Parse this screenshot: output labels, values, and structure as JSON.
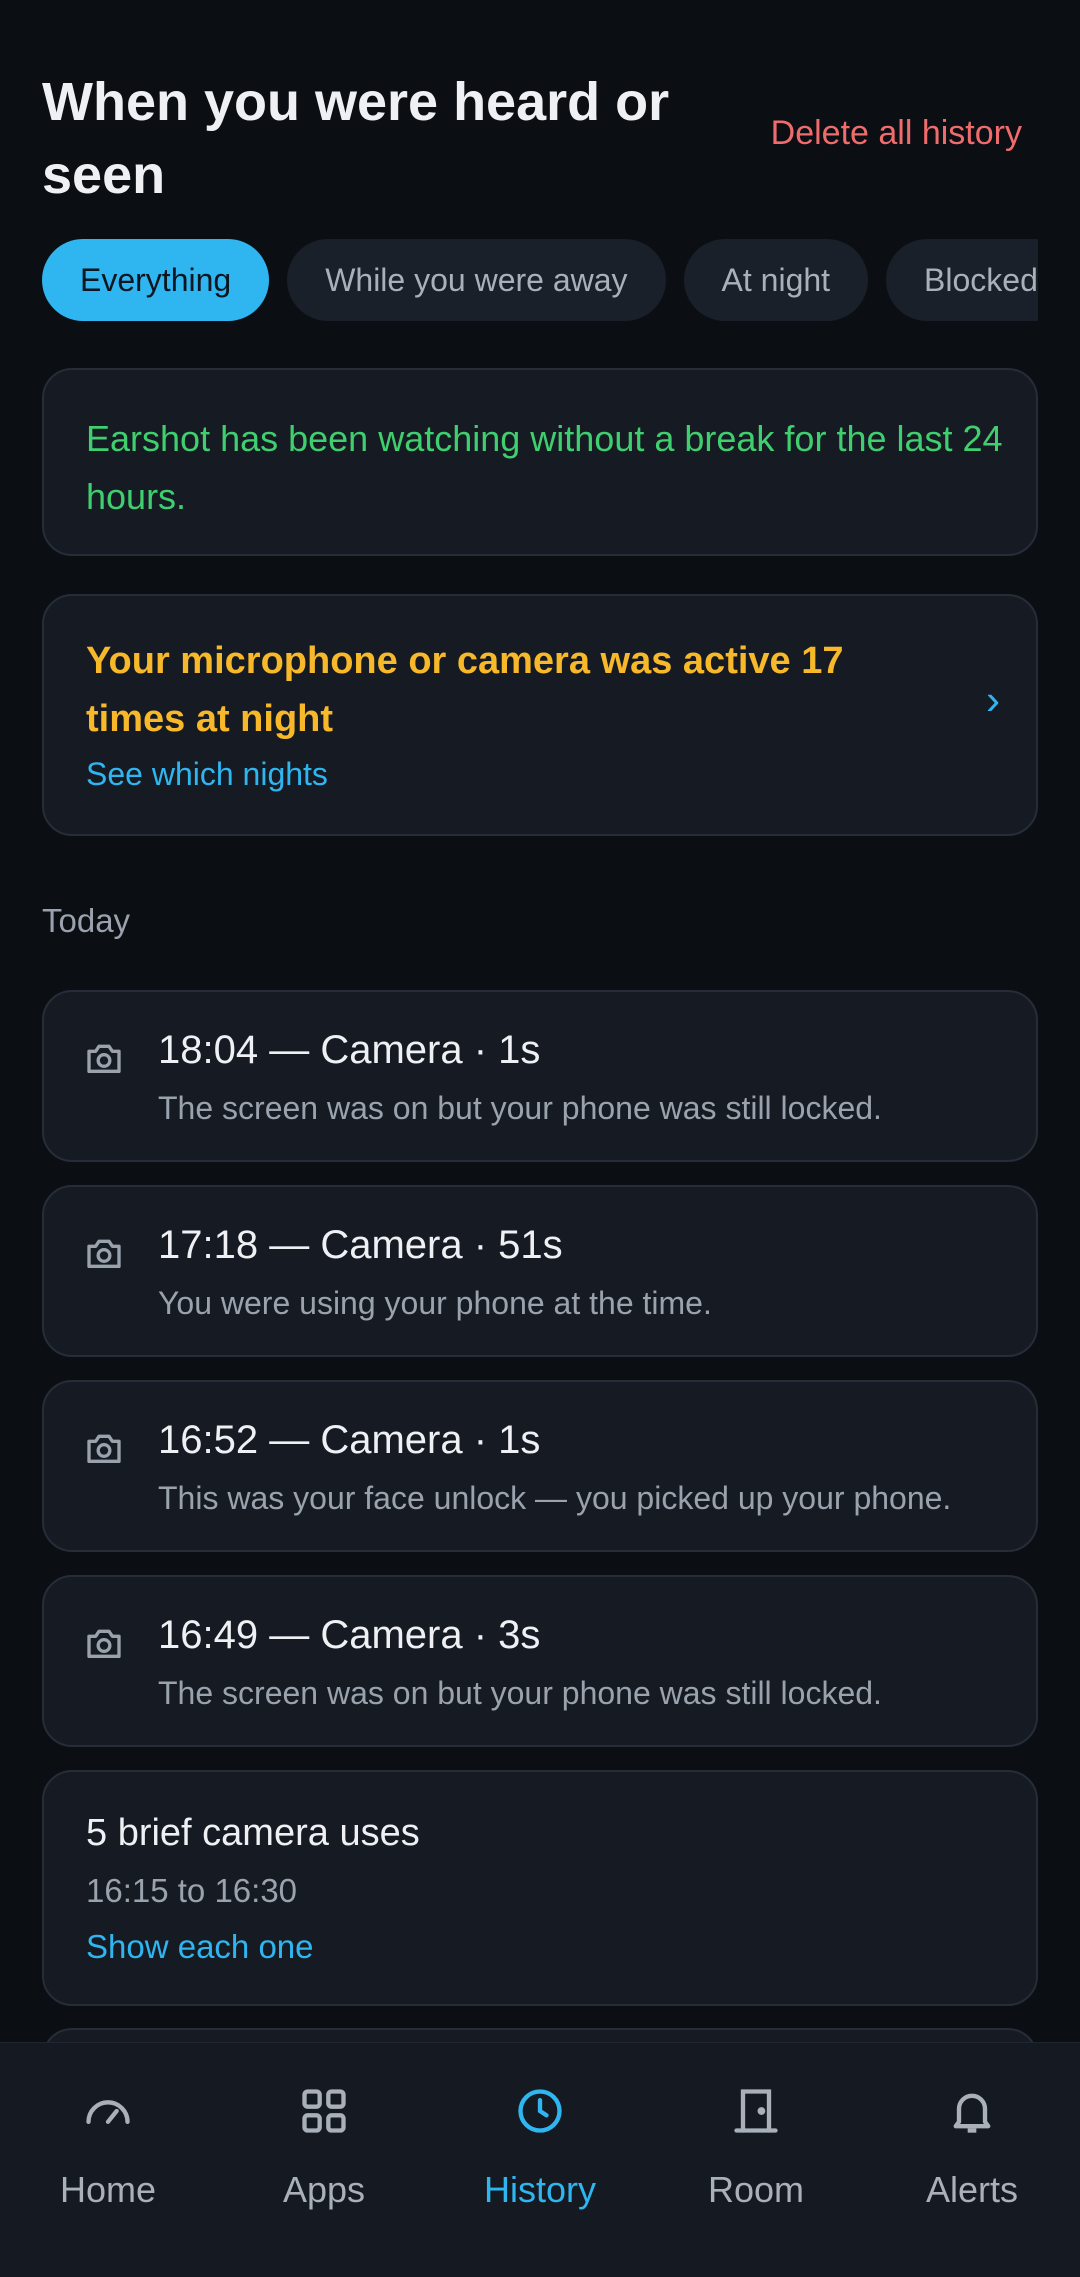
{
  "header": {
    "title": "When you were heard or seen",
    "delete_label": "Delete all history"
  },
  "filters": [
    {
      "label": "Everything",
      "active": true
    },
    {
      "label": "While you were away",
      "active": false
    },
    {
      "label": "At night",
      "active": false
    },
    {
      "label": "Blocked",
      "active": false
    }
  ],
  "watch_status": "Earshot has been watching without a break for the last 24 hours.",
  "night_alert": {
    "title": "Your microphone or camera was active 17 times at night",
    "link": "See which nights"
  },
  "section_label": "Today",
  "events": [
    {
      "title": "18:04 — Camera · 1s",
      "subtitle": "The screen was on but your phone was still locked.",
      "icon": "camera-icon"
    },
    {
      "title": "17:18 — Camera · 51s",
      "subtitle": "You were using your phone at the time.",
      "icon": "camera-icon"
    },
    {
      "title": "16:52 — Camera · 1s",
      "subtitle": "This was your face unlock — you picked up your phone.",
      "icon": "camera-icon"
    },
    {
      "title": "16:49 — Camera · 3s",
      "subtitle": "The screen was on but your phone was still locked.",
      "icon": "camera-icon"
    }
  ],
  "brief_group": {
    "title": "5 brief camera uses",
    "range": "16:15 to 16:30",
    "link": "Show each one"
  },
  "nav": [
    {
      "label": "Home",
      "icon": "gauge-icon",
      "active": false
    },
    {
      "label": "Apps",
      "icon": "grid-icon",
      "active": false
    },
    {
      "label": "History",
      "icon": "clock-icon",
      "active": true
    },
    {
      "label": "Room",
      "icon": "door-icon",
      "active": false
    },
    {
      "label": "Alerts",
      "icon": "bell-icon",
      "active": false
    }
  ],
  "colors": {
    "accent": "#2fb6f0",
    "danger": "#f06c6c",
    "success": "#3fcf6e",
    "warning": "#f7b82a",
    "background": "#0b0e13",
    "card": "#161b23"
  }
}
